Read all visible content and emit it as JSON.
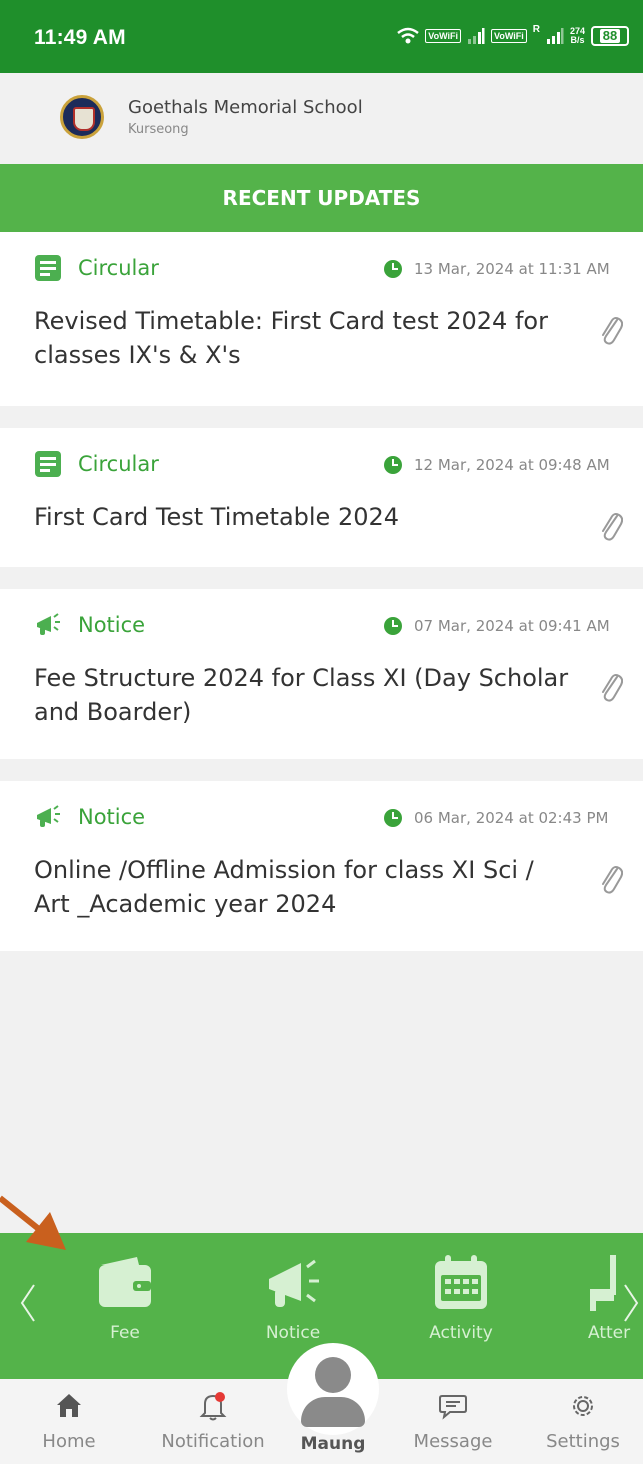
{
  "status_bar": {
    "time": "11:49 AM",
    "network_tag_1": "VoWiFi",
    "network_tag_2": "VoWiFi",
    "roaming": "R",
    "speed_value": "274",
    "speed_unit": "B/s",
    "battery": "88",
    "icons": [
      "wifi-icon",
      "signal-icon",
      "signal-icon",
      "battery-icon"
    ]
  },
  "school": {
    "name": "Goethals Memorial School",
    "location": "Kurseong"
  },
  "banner": {
    "title": "RECENT UPDATES"
  },
  "updates": [
    {
      "type": "Circular",
      "icon": "document-icon",
      "date": "13 Mar, 2024 at 11:31 AM",
      "title": "Revised Timetable: First Card test 2024 for classes IX's & X's",
      "attachment": true
    },
    {
      "type": "Circular",
      "icon": "document-icon",
      "date": "12 Mar, 2024 at 09:48 AM",
      "title": "First Card Test Timetable 2024",
      "attachment": true
    },
    {
      "type": "Notice",
      "icon": "megaphone-icon",
      "date": "07 Mar, 2024 at 09:41 AM",
      "title": "Fee Structure 2024 for Class XI (Day Scholar and Boarder)",
      "attachment": true
    },
    {
      "type": "Notice",
      "icon": "megaphone-icon",
      "date": "06 Mar, 2024 at 02:43 PM",
      "title": "Online /Offline Admission for class XI Sci / Art _Academic year 2024",
      "attachment": true
    }
  ],
  "quick_actions": [
    {
      "label": "Fee",
      "icon": "wallet-icon"
    },
    {
      "label": "Notice",
      "icon": "megaphone-icon"
    },
    {
      "label": "Activity",
      "icon": "calendar-icon"
    },
    {
      "label": "Atter",
      "icon": "chair-icon"
    }
  ],
  "bottom_nav": {
    "home": "Home",
    "notification": "Notification",
    "profile": "Maung",
    "message": "Message",
    "settings": "Settings"
  },
  "colors": {
    "status_bar": "#1f8f2b",
    "accent_green": "#54b34a",
    "label_green": "#3aa33a",
    "annotation_arrow": "#c9601e"
  }
}
